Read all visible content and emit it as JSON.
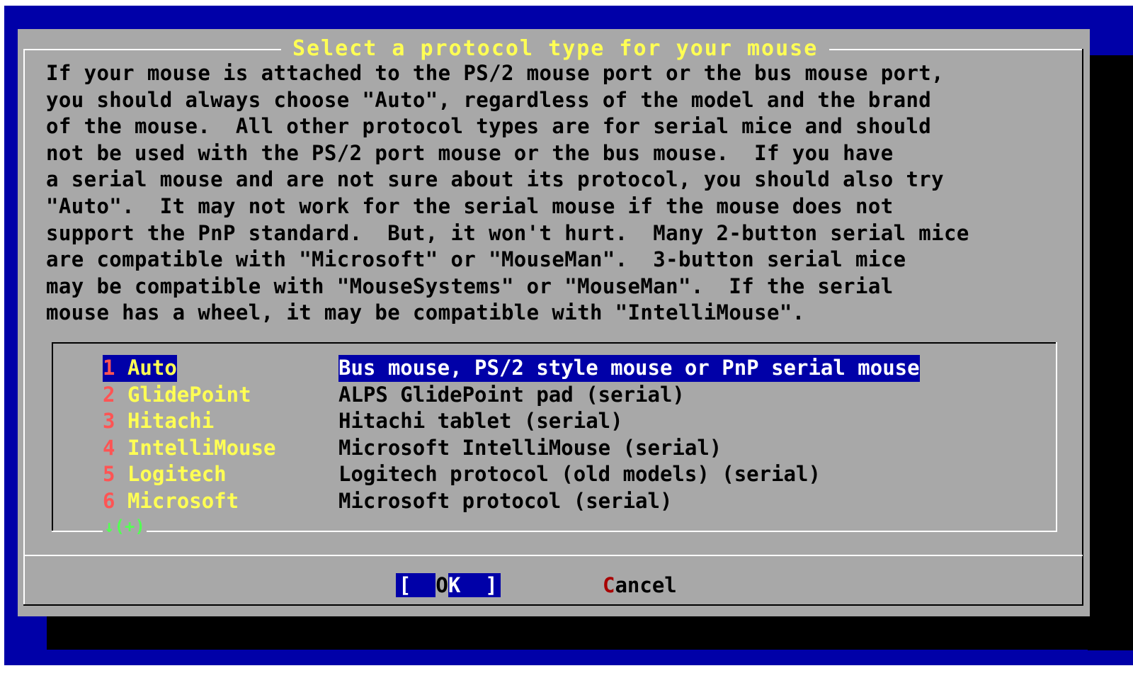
{
  "dialog": {
    "title": "Select a protocol type for your mouse",
    "description": "If your mouse is attached to the PS/2 mouse port or the bus mouse port,\nyou should always choose \"Auto\", regardless of the model and the brand\nof the mouse.  All other protocol types are for serial mice and should\nnot be used with the PS/2 port mouse or the bus mouse.  If you have\na serial mouse and are not sure about its protocol, you should also try\n\"Auto\".  It may not work for the serial mouse if the mouse does not\nsupport the PnP standard.  But, it won't hurt.  Many 2-button serial mice\nare compatible with \"Microsoft\" or \"MouseMan\".  3-button serial mice\nmay be compatible with \"MouseSystems\" or \"MouseMan\".  If the serial\nmouse has a wheel, it may be compatible with \"IntelliMouse\"."
  },
  "list": {
    "items": [
      {
        "num": "1",
        "name": "Auto",
        "desc": "Bus mouse, PS/2 style mouse or PnP serial mouse",
        "selected": true
      },
      {
        "num": "2",
        "name": "GlidePoint",
        "desc": "ALPS GlidePoint pad (serial)"
      },
      {
        "num": "3",
        "name": "Hitachi",
        "desc": "Hitachi tablet (serial)"
      },
      {
        "num": "4",
        "name": "IntelliMouse",
        "desc": "Microsoft IntelliMouse (serial)"
      },
      {
        "num": "5",
        "name": "Logitech",
        "desc": "Logitech protocol (old models) (serial)"
      },
      {
        "num": "6",
        "name": "Microsoft",
        "desc": "Microsoft protocol (serial)"
      }
    ],
    "more_indicator": "↓(+)"
  },
  "buttons": {
    "ok": {
      "open": "[  ",
      "hotkey": "O",
      "rest": "K  ]"
    },
    "cancel": {
      "hotkey": "C",
      "rest": "ancel"
    }
  },
  "colors": {
    "background": "#0000a8",
    "dialog": "#a8a8a8",
    "title": "#ffff54",
    "hotkey_number": "#ff5454",
    "selection": "#0000a8",
    "more_indicator": "#54ff54"
  }
}
